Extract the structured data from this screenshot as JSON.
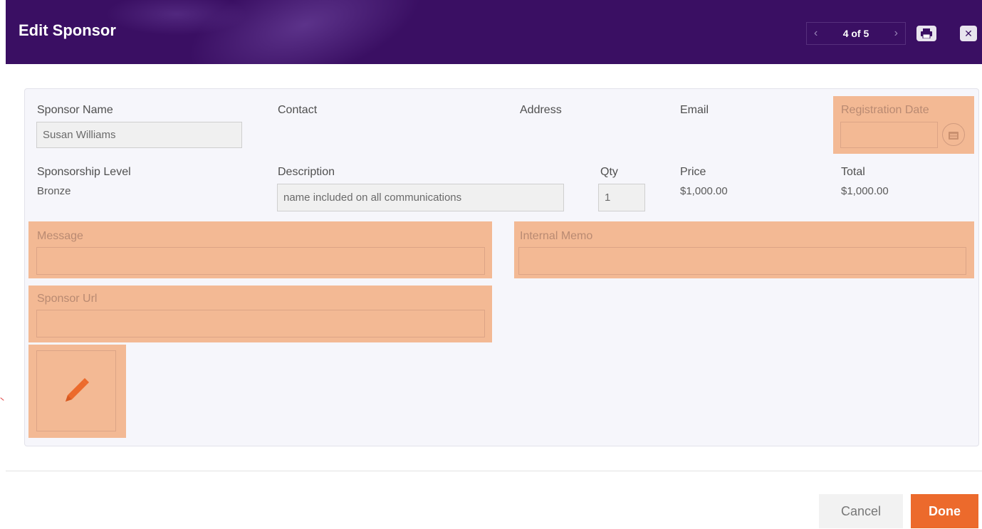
{
  "dialog": {
    "title": "Edit Sponsor",
    "pager": {
      "label": "4 of 5",
      "prev_icon": "chevron-left-icon",
      "next_icon": "chevron-right-icon"
    },
    "print_icon": "print-icon",
    "close_icon": "close-icon"
  },
  "fields": {
    "sponsor_name": {
      "label": "Sponsor Name",
      "value": "Susan Williams"
    },
    "contact": {
      "label": "Contact"
    },
    "address": {
      "label": "Address"
    },
    "email": {
      "label": "Email"
    },
    "registration_date": {
      "label": "Registration Date",
      "value": ""
    },
    "sponsorship_level": {
      "label": "Sponsorship Level",
      "value": "Bronze"
    },
    "description": {
      "label": "Description",
      "value": "name included on all communications"
    },
    "qty": {
      "label": "Qty",
      "value": "1"
    },
    "price": {
      "label": "Price",
      "value": "$1,000.00"
    },
    "total": {
      "label": "Total",
      "value": "$1,000.00"
    },
    "message": {
      "label": "Message",
      "value": ""
    },
    "internal_memo": {
      "label": "Internal Memo",
      "value": ""
    },
    "sponsor_url": {
      "label": "Sponsor Url",
      "value": ""
    }
  },
  "footer": {
    "cancel_label": "Cancel",
    "done_label": "Done"
  },
  "colors": {
    "header_bg": "#3a0f63",
    "highlight": "#f3b994",
    "accent": "#ec6a2c"
  }
}
